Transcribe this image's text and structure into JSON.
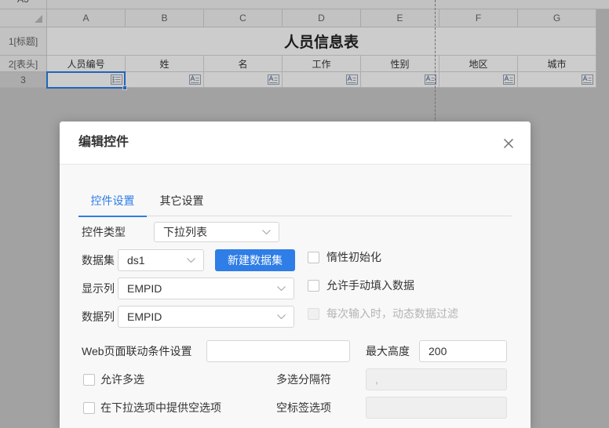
{
  "sheet": {
    "name_box": "A3",
    "columns": [
      "A",
      "B",
      "C",
      "D",
      "E",
      "F",
      "G"
    ],
    "row_headers": [
      "1[标题]",
      "2[表头]",
      "3"
    ],
    "title": "人员信息表",
    "headers": [
      "人员编号",
      "姓",
      "名",
      "工作",
      "性别",
      "地区",
      "城市"
    ],
    "row3_widget_icons": [
      "dropdown-widget-icon",
      "text-widget-icon",
      "text-widget-icon",
      "text-widget-icon",
      "text-widget-icon",
      "text-widget-icon",
      "text-widget-icon"
    ]
  },
  "dialog": {
    "title": "编辑控件",
    "close_icon": "close-icon",
    "tabs": [
      {
        "label": "控件设置",
        "active": true
      },
      {
        "label": "其它设置",
        "active": false
      }
    ],
    "widget_type": {
      "label": "控件类型",
      "value": "下拉列表"
    },
    "dataset": {
      "label": "数据集",
      "value": "ds1",
      "new_button": "新建数据集"
    },
    "display_column": {
      "label": "显示列",
      "value": "EMPID"
    },
    "data_column": {
      "label": "数据列",
      "value": "EMPID"
    },
    "lazy_init": {
      "label": "惰性初始化",
      "checked": false
    },
    "allow_manual_input": {
      "label": "允许手动填入数据",
      "checked": false
    },
    "dynamic_filter": {
      "label": "每次输入时，动态数据过滤",
      "checked": false,
      "disabled": true
    },
    "web_linkage": {
      "label": "Web页面联动条件设置",
      "value": ""
    },
    "max_height": {
      "label": "最大高度",
      "value": "200"
    },
    "multi_select": {
      "label": "允许多选",
      "checked": false
    },
    "separator": {
      "label": "多选分隔符",
      "value": ",",
      "disabled": true
    },
    "empty_option": {
      "label": "在下拉选项中提供空选项",
      "checked": false
    },
    "empty_label": {
      "label": "空标签选项",
      "value": "",
      "disabled": true
    }
  },
  "colors": {
    "accent": "#2f7de6",
    "overlay": "rgba(0,0,0,0.2)",
    "disabled_text": "#b4b4b4"
  }
}
